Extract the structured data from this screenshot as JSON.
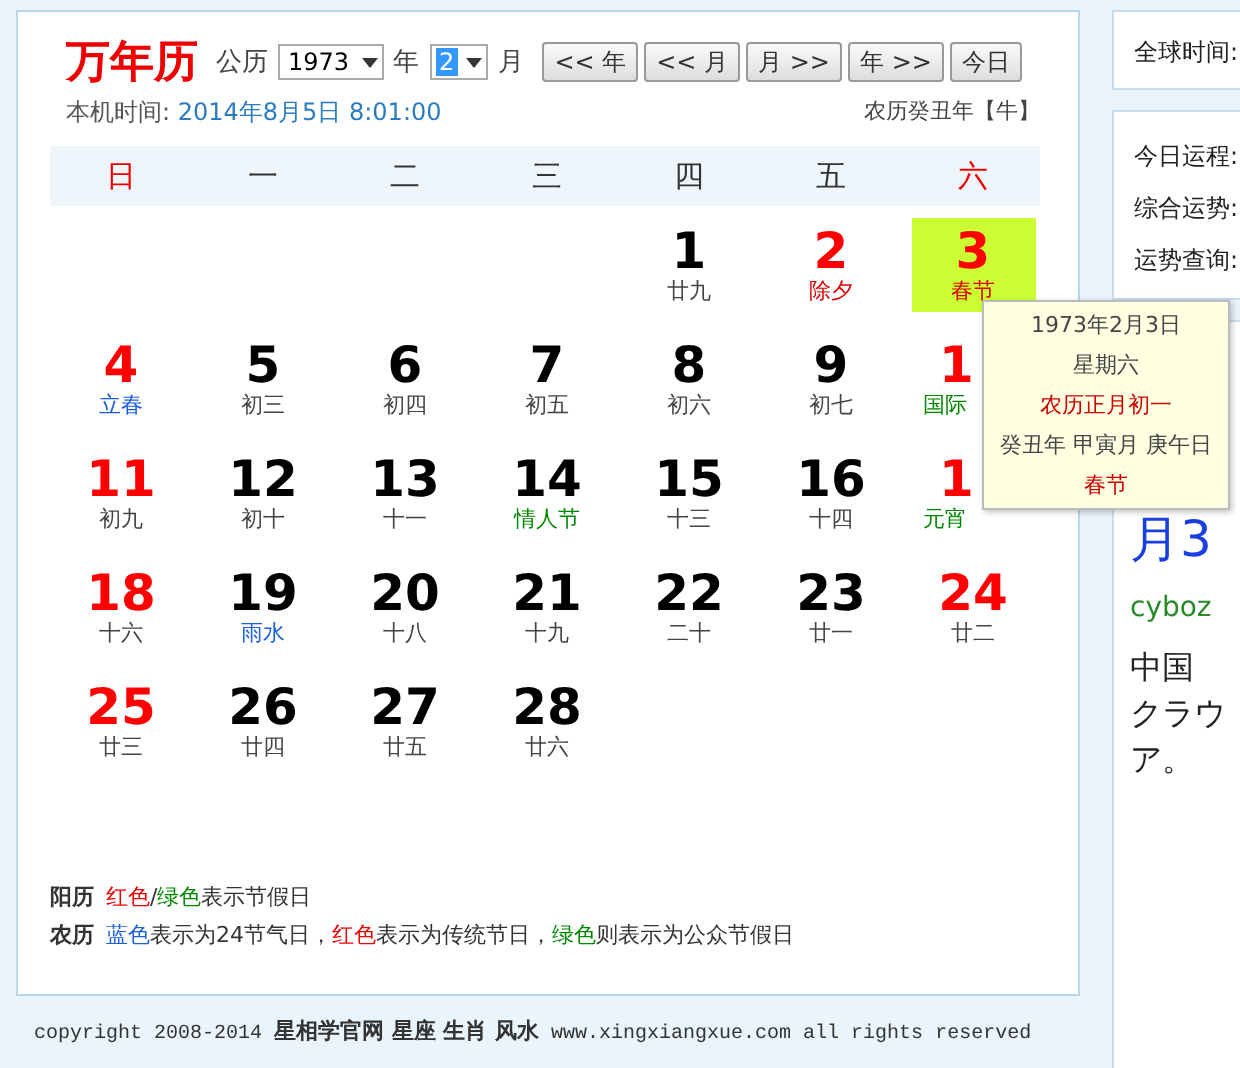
{
  "logo": "万年历",
  "toolbar": {
    "calendar_label": "公历",
    "year_select": {
      "value": "1973"
    },
    "year_label": "年",
    "month_select": {
      "value": "2",
      "selected": true
    },
    "month_label": "月",
    "buttons": [
      "<< 年",
      "<< 月",
      "月 >>",
      "年 >>",
      "今日"
    ]
  },
  "clock": {
    "label": "本机时间:",
    "value": "2014年8月5日 8:01:00"
  },
  "lunar_year": "农历癸丑年【牛】",
  "weekdays": [
    {
      "label": "日",
      "red": true
    },
    {
      "label": "一",
      "red": false
    },
    {
      "label": "二",
      "red": false
    },
    {
      "label": "三",
      "red": false
    },
    {
      "label": "四",
      "red": false
    },
    {
      "label": "五",
      "red": false
    },
    {
      "label": "六",
      "red": true
    }
  ],
  "days": [
    {
      "day": "1",
      "lunar": "廿九",
      "red": false,
      "color": "#444444",
      "selected": false
    },
    {
      "day": "2",
      "lunar": "除夕",
      "red": true,
      "color": "#dd0000",
      "selected": false
    },
    {
      "day": "3",
      "lunar": "春节",
      "red": true,
      "color": "#dd0000",
      "selected": true
    },
    {
      "day": "4",
      "lunar": "立春",
      "red": true,
      "color": "#1a5fe0",
      "selected": false
    },
    {
      "day": "5",
      "lunar": "初三",
      "red": false,
      "color": "#444444",
      "selected": false
    },
    {
      "day": "6",
      "lunar": "初四",
      "red": false,
      "color": "#444444",
      "selected": false
    },
    {
      "day": "7",
      "lunar": "初五",
      "red": false,
      "color": "#444444",
      "selected": false
    },
    {
      "day": "8",
      "lunar": "初六",
      "red": false,
      "color": "#444444",
      "selected": false
    },
    {
      "day": "9",
      "lunar": "初七",
      "red": false,
      "color": "#444444",
      "selected": false
    },
    {
      "day": "1",
      "lunar": "国际",
      "red": true,
      "color": "#008800",
      "selected": false,
      "cut_off": true
    },
    {
      "day": "11",
      "lunar": "初九",
      "red": true,
      "color": "#444444",
      "selected": false
    },
    {
      "day": "12",
      "lunar": "初十",
      "red": false,
      "color": "#444444",
      "selected": false
    },
    {
      "day": "13",
      "lunar": "十一",
      "red": false,
      "color": "#444444",
      "selected": false
    },
    {
      "day": "14",
      "lunar": "情人节",
      "red": false,
      "color": "#008800",
      "selected": false
    },
    {
      "day": "15",
      "lunar": "十三",
      "red": false,
      "color": "#444444",
      "selected": false
    },
    {
      "day": "16",
      "lunar": "十四",
      "red": false,
      "color": "#444444",
      "selected": false
    },
    {
      "day": "1",
      "lunar": "元宵",
      "red": true,
      "color": "#008800",
      "selected": false,
      "cut_off": true
    },
    {
      "day": "18",
      "lunar": "十六",
      "red": true,
      "color": "#444444",
      "selected": false
    },
    {
      "day": "19",
      "lunar": "雨水",
      "red": false,
      "color": "#1a5fe0",
      "selected": false
    },
    {
      "day": "20",
      "lunar": "十八",
      "red": false,
      "color": "#444444",
      "selected": false
    },
    {
      "day": "21",
      "lunar": "十九",
      "red": false,
      "color": "#444444",
      "selected": false
    },
    {
      "day": "22",
      "lunar": "二十",
      "red": false,
      "color": "#444444",
      "selected": false
    },
    {
      "day": "23",
      "lunar": "廿一",
      "red": false,
      "color": "#444444",
      "selected": false
    },
    {
      "day": "24",
      "lunar": "廿二",
      "red": true,
      "color": "#444444",
      "selected": false
    },
    {
      "day": "25",
      "lunar": "廿三",
      "red": true,
      "color": "#444444",
      "selected": false
    },
    {
      "day": "26",
      "lunar": "廿四",
      "red": false,
      "color": "#444444",
      "selected": false
    },
    {
      "day": "27",
      "lunar": "廿五",
      "red": false,
      "color": "#444444",
      "selected": false
    },
    {
      "day": "28",
      "lunar": "廿六",
      "red": false,
      "color": "#444444",
      "selected": false
    }
  ],
  "tooltip": {
    "lines": [
      {
        "text": "1973年2月3日",
        "kind": "plain"
      },
      {
        "text": "星期六",
        "kind": "plain"
      },
      {
        "text": "农历正月初一",
        "kind": "red"
      },
      {
        "text": "癸丑年 甲寅月 庚午日",
        "kind": "plain"
      },
      {
        "text": "春节",
        "kind": "red"
      }
    ]
  },
  "legend": [
    {
      "label": "阳历",
      "parts": [
        {
          "text": "红色",
          "kind": "red"
        },
        {
          "text": "/",
          "kind": "plain"
        },
        {
          "text": "绿色",
          "kind": "green"
        },
        {
          "text": "表示节假日",
          "kind": "plain"
        }
      ]
    },
    {
      "label": "农历",
      "parts": [
        {
          "text": "蓝色",
          "kind": "blue"
        },
        {
          "text": "表示为24节气日，",
          "kind": "plain"
        },
        {
          "text": "红色",
          "kind": "red"
        },
        {
          "text": "表示为传统节日，",
          "kind": "plain"
        },
        {
          "text": "绿色",
          "kind": "green"
        },
        {
          "text": "则表示为公众节假日",
          "kind": "plain"
        }
      ]
    }
  ],
  "footer": {
    "copyright": "copyright 2008-2014",
    "links": "星相学官网 星座 生肖 风水",
    "site": "www.xingxiangxue.com all rights reserved"
  },
  "sidebar": {
    "world_time": "全球时间:",
    "fortune_labels": [
      "今日运程:",
      "综合运势:",
      "运势查询:"
    ],
    "headline": "月3",
    "source": "cyboz",
    "text_lines": [
      "中国",
      "クラウ",
      "ア。"
    ]
  }
}
